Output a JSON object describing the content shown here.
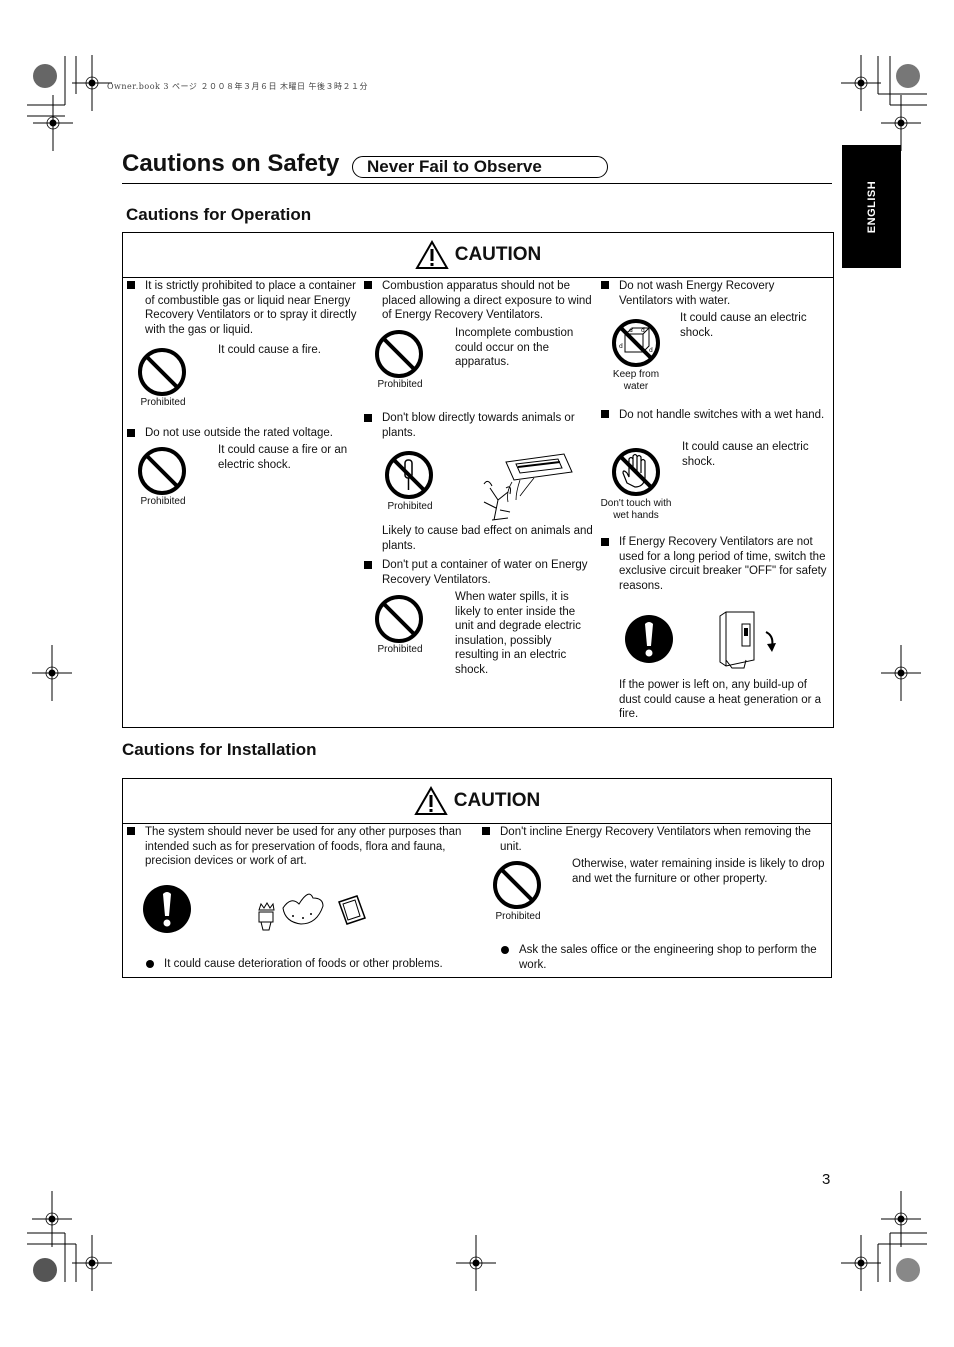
{
  "print_meta": "Owner.book  3 ページ  ２００８年３月６日  木曜日  午後３時２１分",
  "language_tab": "ENGLISH",
  "header": {
    "title": "Cautions on Safety",
    "subtitle": "Never Fail to Observe"
  },
  "operation": {
    "section_title": "Cautions for Operation",
    "caution_label": "CAUTION",
    "col1": [
      {
        "text": "It is strictly prohibited to place a container of combustible gas or liquid near Energy Recovery Ventilators or to spray it directly with the gas or liquid.",
        "note": "It could cause a fire.",
        "icon_caption": "Prohibited"
      },
      {
        "text": "Do not use outside the rated voltage.",
        "note": "It could cause a fire or an electric shock.",
        "icon_caption": "Prohibited"
      }
    ],
    "col2": [
      {
        "text": "Combustion apparatus should not be placed allowing a direct exposure to wind of Energy Recovery Ventilators.",
        "note": "Incomplete combustion could occur on the apparatus.",
        "icon_caption": "Prohibited"
      },
      {
        "text": "Don't blow directly towards animals or plants.",
        "note": "Likely to cause bad effect on animals and plants.",
        "icon_caption": "Prohibited"
      },
      {
        "text": "Don't put a container of water on Energy Recovery Ventilators.",
        "note": "When water spills, it is likely to enter inside the unit and degrade electric insulation, possibly resulting in an electric shock.",
        "icon_caption": "Prohibited"
      }
    ],
    "col3": [
      {
        "text": "Do not wash Energy Recovery Ventilators with water.",
        "note": "It could cause an electric shock.",
        "icon_caption": "Keep from water"
      },
      {
        "text": "Do not handle switches with a wet hand.",
        "note": "It could cause an electric shock.",
        "icon_caption": "Don't touch with wet hands"
      },
      {
        "text": "If Energy Recovery Ventilators are not used for a long period of time, switch the exclusive circuit breaker \"OFF\" for safety reasons.",
        "note": "If the power is left on, any build-up of dust could cause a heat generation or a fire."
      }
    ]
  },
  "installation": {
    "section_title": "Cautions for Installation",
    "caution_label": "CAUTION",
    "left": {
      "text": "The system should never be used for any other purposes than intended such as for preservation of foods, flora and fauna, precision devices or work of art.",
      "note": "It could cause deterioration of foods or other problems."
    },
    "right": {
      "text": "Don't incline Energy Recovery Ventilators when removing the unit.",
      "note": "Otherwise, water remaining inside is likely to drop and wet the furniture or other property.",
      "icon_caption": "Prohibited",
      "sub_note": "Ask the sales office or the engineering shop to perform the work."
    }
  },
  "page_number": "3"
}
